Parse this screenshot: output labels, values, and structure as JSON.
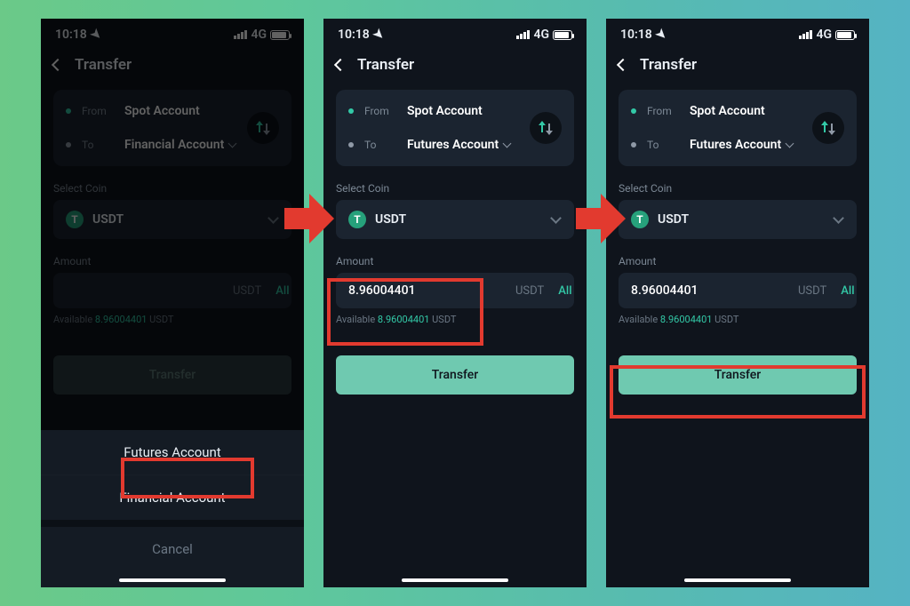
{
  "status": {
    "time": "10:18",
    "network": "4G"
  },
  "header": {
    "title": "Transfer"
  },
  "card": {
    "from_label": "From",
    "to_label": "To",
    "from_account": "Spot Account"
  },
  "screens": [
    {
      "to_account": "Financial Account",
      "amount_value": "",
      "transfer_enabled": false
    },
    {
      "to_account": "Futures Account",
      "amount_value": "8.96004401",
      "transfer_enabled": true
    },
    {
      "to_account": "Futures Account",
      "amount_value": "8.96004401",
      "transfer_enabled": true
    }
  ],
  "sections": {
    "select_coin": "Select Coin",
    "amount": "Amount"
  },
  "coin": {
    "badge": "T",
    "name": "USDT"
  },
  "amount": {
    "unit": "USDT",
    "all": "All"
  },
  "available": {
    "label": "Available",
    "value": "8.96004401",
    "unit": "USDT"
  },
  "transfer_label": "Transfer",
  "sheet": {
    "option1": "Futures Account",
    "option2": "Financial Account",
    "cancel": "Cancel"
  }
}
